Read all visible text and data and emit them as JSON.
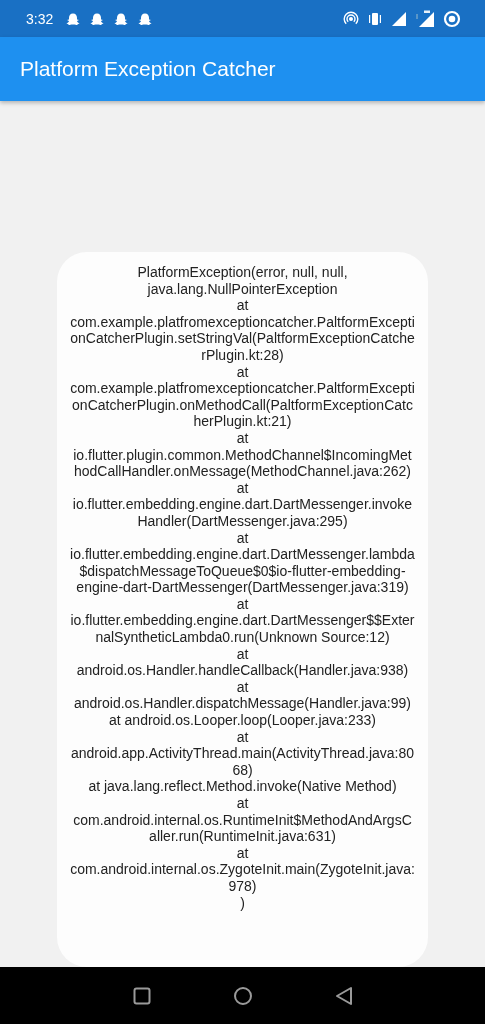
{
  "status_bar": {
    "time": "3:32"
  },
  "app_bar": {
    "title": "Platform Exception Catcher"
  },
  "dialog": {
    "message": "PlatformException(error, null, null, java.lang.NullPointerException\nat com.example.platfromexceptioncatcher.PaltformExceptionCatcherPlugin.setStringVal(PaltformExceptionCatcherPlugin.kt:28)\nat com.example.platfromexceptioncatcher.PaltformExceptionCatcherPlugin.onMethodCall(PaltformExceptionCatcherPlugin.kt:21)\nat io.flutter.plugin.common.MethodChannel$IncomingMethodCallHandler.onMessage(MethodChannel.java:262)\nat io.flutter.embedding.engine.dart.DartMessenger.invokeHandler(DartMessenger.java:295)\nat io.flutter.embedding.engine.dart.DartMessenger.lambda$dispatchMessageToQueue$0$io-flutter-embedding-engine-dart-DartMessenger(DartMessenger.java:319)\nat io.flutter.embedding.engine.dart.DartMessenger$$ExternalSyntheticLambda0.run(Unknown Source:12)\nat android.os.Handler.handleCallback(Handler.java:938)\nat android.os.Handler.dispatchMessage(Handler.java:99)\nat android.os.Looper.loop(Looper.java:233)\nat android.app.ActivityThread.main(ActivityThread.java:8068)\nat java.lang.reflect.Method.invoke(Native Method)\nat com.android.internal.os.RuntimeInit$MethodAndArgsCaller.run(RuntimeInit.java:631)\nat com.android.internal.os.ZygoteInit.main(ZygoteInit.java:978)\n)"
  }
}
